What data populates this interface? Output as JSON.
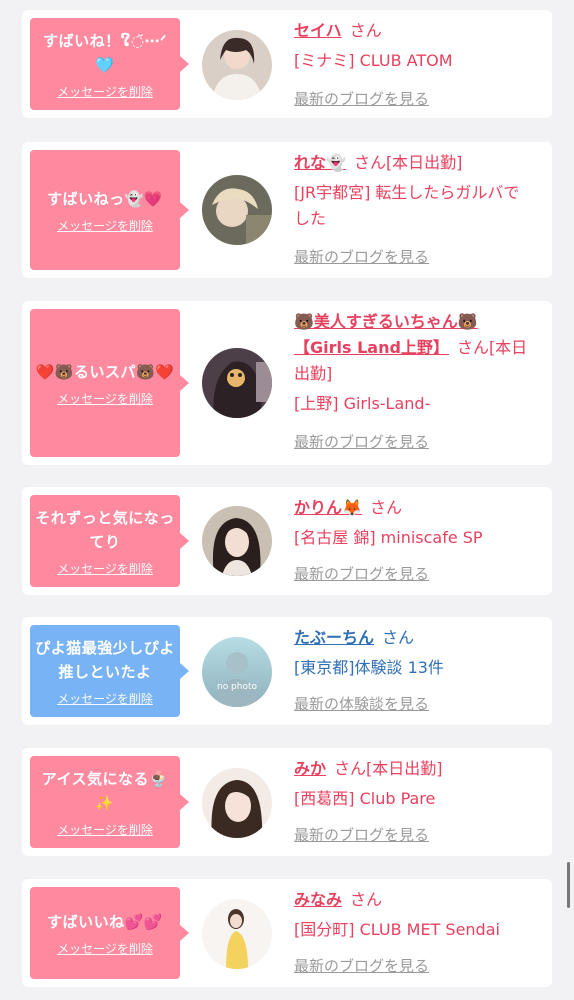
{
  "delete_label": "メッセージを削除",
  "cards": [
    {
      "message": "すばいね！ໃ◌̆⋯ᐟ 🩵",
      "name": "セイハ",
      "san": "さん",
      "shop": "[ミナミ] CLUB ATOM",
      "link": "最新のブログを見る",
      "theme": "pink"
    },
    {
      "message": "すばいねっ👻💗",
      "name": "れな👻",
      "san": "さん[本日出勤]",
      "shop": "[JR宇都宮] 転生したらガルバでした",
      "link": "最新のブログを見る",
      "theme": "pink"
    },
    {
      "message": "❤️🐻るいスパ🐻❤️",
      "name": "🐻美人すぎるいちゃん🐻【Girls Land上野】",
      "san": "さん[本日出勤]",
      "shop": "[上野] Girls-Land-",
      "link": "最新のブログを見る",
      "theme": "pink"
    },
    {
      "message": "それずっと気になってり",
      "name": "かりん🦊",
      "san": "さん",
      "shop": "[名古屋 錦] miniscafe SP",
      "link": "最新のブログを見る",
      "theme": "pink"
    },
    {
      "message": "ぴよ猫最強少しぴよ推しといたよ",
      "name": "たぶーちん",
      "san": "さん",
      "shop": "[東京都]体験談 13件",
      "link": "最新の体験談を見る",
      "avatar_text": "no photo",
      "theme": "blue"
    },
    {
      "message": "アイス気になる🍨✨",
      "name": "みか",
      "san": "さん[本日出勤]",
      "shop": "[西葛西] Club Pare",
      "link": "最新のブログを見る",
      "theme": "pink"
    },
    {
      "message": "すばいいね💕💕",
      "name": "みなみ",
      "san": "さん",
      "shop": "[国分町] CLUB MET Sendai",
      "link": "最新のブログを見る",
      "theme": "pink"
    }
  ]
}
